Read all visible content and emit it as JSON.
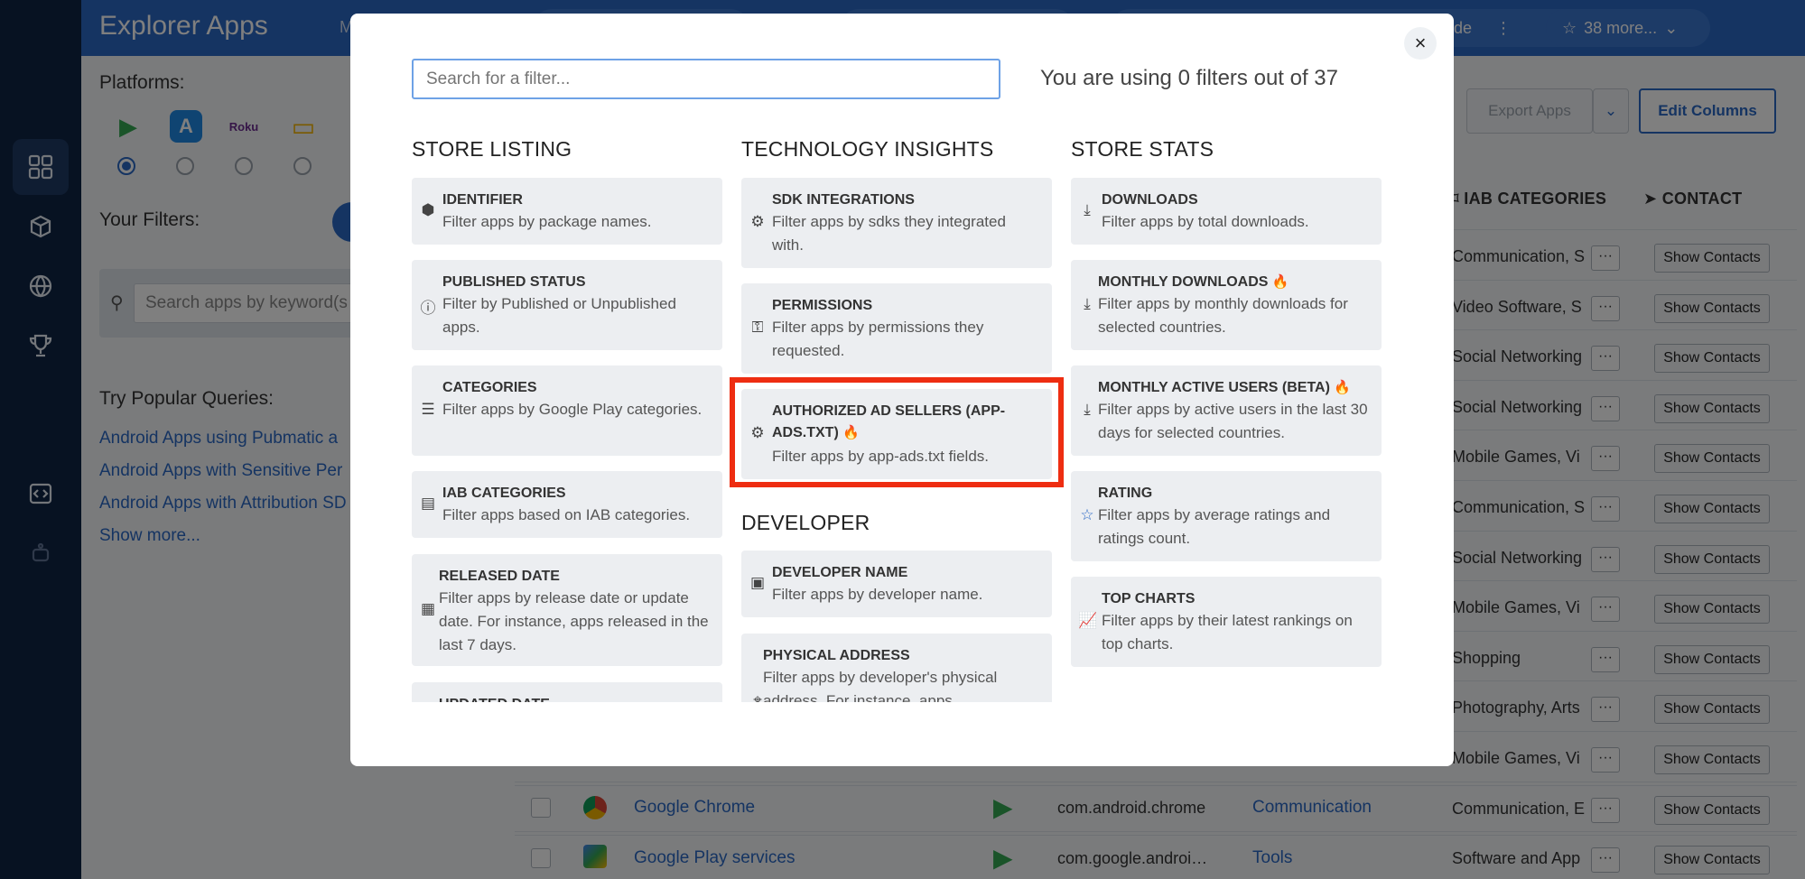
{
  "app": {
    "title": "Explorer Apps",
    "menu_fragment": "M",
    "header_fragment": "de",
    "more_filters": "38 more...",
    "header_dots": "⋮"
  },
  "sidebar": {
    "icons": [
      "grid-icon",
      "cube-icon",
      "globe-icon",
      "trophy-icon",
      "code-icon",
      "robot-icon"
    ]
  },
  "left_panel": {
    "platforms_label": "Platforms:",
    "platforms": [
      {
        "name": "google-play-icon",
        "label": "▶",
        "color": "#34a853"
      },
      {
        "name": "app-store-icon",
        "label": "A",
        "color": "#1e88e5"
      },
      {
        "name": "roku-icon",
        "label": "Roku",
        "color": "#6c2c91"
      },
      {
        "name": "tv-icon",
        "label": "▭",
        "color": "#f4b400"
      }
    ],
    "filters_label": "Your Filters:",
    "search_placeholder": "Search apps by keyword(s",
    "popular_label": "Try Popular Queries:",
    "popular_links": [
      "Android Apps using Pubmatic a",
      "Android Apps with Sensitive Per",
      "Android Apps with Attribution SD"
    ],
    "show_more": "Show more..."
  },
  "table": {
    "export_label": "Export Apps",
    "edit_columns_label": "Edit Columns",
    "col_iab": "IAB CATEGORIES",
    "col_contact": "CONTACT",
    "show_contacts": "Show Contacts",
    "dots": "···",
    "iab_values": [
      "Communication, S",
      "Video Software, S",
      "Social Networking",
      "Social Networking",
      "Mobile Games, Vi",
      "Communication, S",
      "Social Networking",
      "Mobile Games, Vi",
      "Shopping",
      "Photography, Arts",
      "Mobile Games, Vi",
      "Communication, E",
      "Software and App"
    ],
    "visible_rows": [
      {
        "name": "Google Chrome",
        "package": "com.android.chrome",
        "category": "Communication"
      },
      {
        "name": "Google Play services",
        "package": "com.google.androi…",
        "category": "Tools"
      }
    ]
  },
  "modal": {
    "search_placeholder": "Search for a filter...",
    "count_text": "You are using 0 filters out of 37",
    "close": "×",
    "columns": {
      "store_listing": "STORE LISTING",
      "tech_insights": "TECHNOLOGY INSIGHTS",
      "developer": "DEVELOPER",
      "store_stats": "STORE STATS"
    },
    "store_listing": [
      {
        "title": "IDENTIFIER",
        "desc": "Filter apps by package names."
      },
      {
        "title": "PUBLISHED STATUS",
        "desc": "Filter by Published or Unpublished apps."
      },
      {
        "title": "CATEGORIES",
        "desc": "Filter apps by Google Play categories."
      },
      {
        "title": "IAB CATEGORIES",
        "desc": "Filter apps based on IAB categories."
      },
      {
        "title": "RELEASED DATE",
        "desc": "Filter apps by release date or update date. For instance, apps released in the last 7 days."
      },
      {
        "title": "UPDATED DATE",
        "desc": ""
      }
    ],
    "tech_insights": [
      {
        "title": "SDK INTEGRATIONS",
        "desc": "Filter apps by sdks they integrated with."
      },
      {
        "title": "PERMISSIONS",
        "desc": "Filter apps by permissions they requested."
      },
      {
        "title": "AUTHORIZED AD SELLERS (APP-ADS.TXT)",
        "desc": "Filter apps by app-ads.txt fields."
      }
    ],
    "developer": [
      {
        "title": "DEVELOPER NAME",
        "desc": "Filter apps by developer name."
      },
      {
        "title": "PHYSICAL ADDRESS",
        "desc": "Filter apps by developer's physical address. For instance, apps"
      }
    ],
    "store_stats": [
      {
        "title": "DOWNLOADS",
        "desc": "Filter apps by total downloads."
      },
      {
        "title": "MONTHLY DOWNLOADS",
        "desc": "Filter apps by monthly downloads for selected countries."
      },
      {
        "title": "MONTHLY ACTIVE USERS (BETA)",
        "desc": "Filter apps by active users in the last 30 days for selected countries."
      },
      {
        "title": "RATING",
        "desc": "Filter apps by average ratings and ratings count."
      },
      {
        "title": "TOP CHARTS",
        "desc": "Filter apps by their latest rankings on top charts."
      }
    ]
  }
}
